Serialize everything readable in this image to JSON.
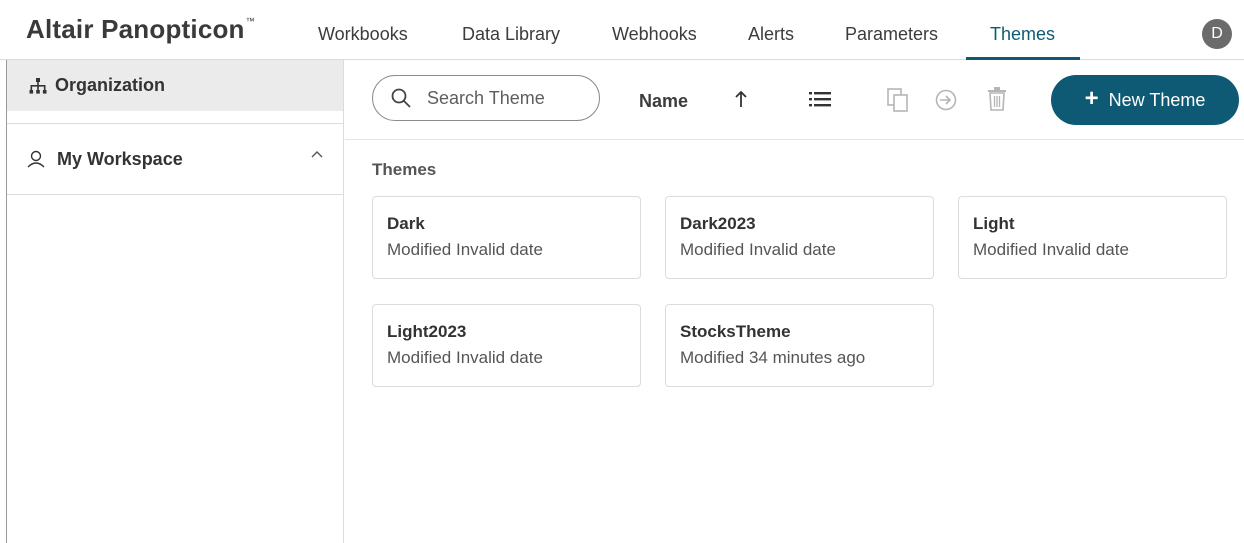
{
  "app": {
    "brand": "Altair Panopticon",
    "brand_mark": "™"
  },
  "nav": {
    "items": [
      {
        "label": "Workbooks"
      },
      {
        "label": "Data Library"
      },
      {
        "label": "Webhooks"
      },
      {
        "label": "Alerts"
      },
      {
        "label": "Parameters"
      },
      {
        "label": "Themes"
      }
    ],
    "active": "Themes"
  },
  "user": {
    "initial": "D"
  },
  "sidebar": {
    "organization_label": "Organization",
    "workspace_label": "My Workspace",
    "icons": [
      "org-chart-icon",
      "user-icon",
      "chevron-up-icon"
    ]
  },
  "toolbar": {
    "search_placeholder": "Search Theme",
    "sort_label": "Name",
    "new_button_label": "New Theme",
    "icons": [
      "search-icon",
      "sort-ascending-icon",
      "list-view-icon",
      "duplicate-icon",
      "move-icon",
      "delete-icon",
      "plus-icon"
    ]
  },
  "content": {
    "section_title": "Themes",
    "cards": [
      {
        "name": "Dark",
        "modified": "Modified Invalid date"
      },
      {
        "name": "Dark2023",
        "modified": "Modified Invalid date"
      },
      {
        "name": "Light",
        "modified": "Modified Invalid date"
      },
      {
        "name": "Light2023",
        "modified": "Modified Invalid date"
      },
      {
        "name": "StocksTheme",
        "modified": "Modified 34 minutes ago"
      }
    ]
  },
  "colors": {
    "accent": "#0e5a74",
    "sidebar_selected": "#ebebeb",
    "avatar": "#6b6b6b"
  }
}
